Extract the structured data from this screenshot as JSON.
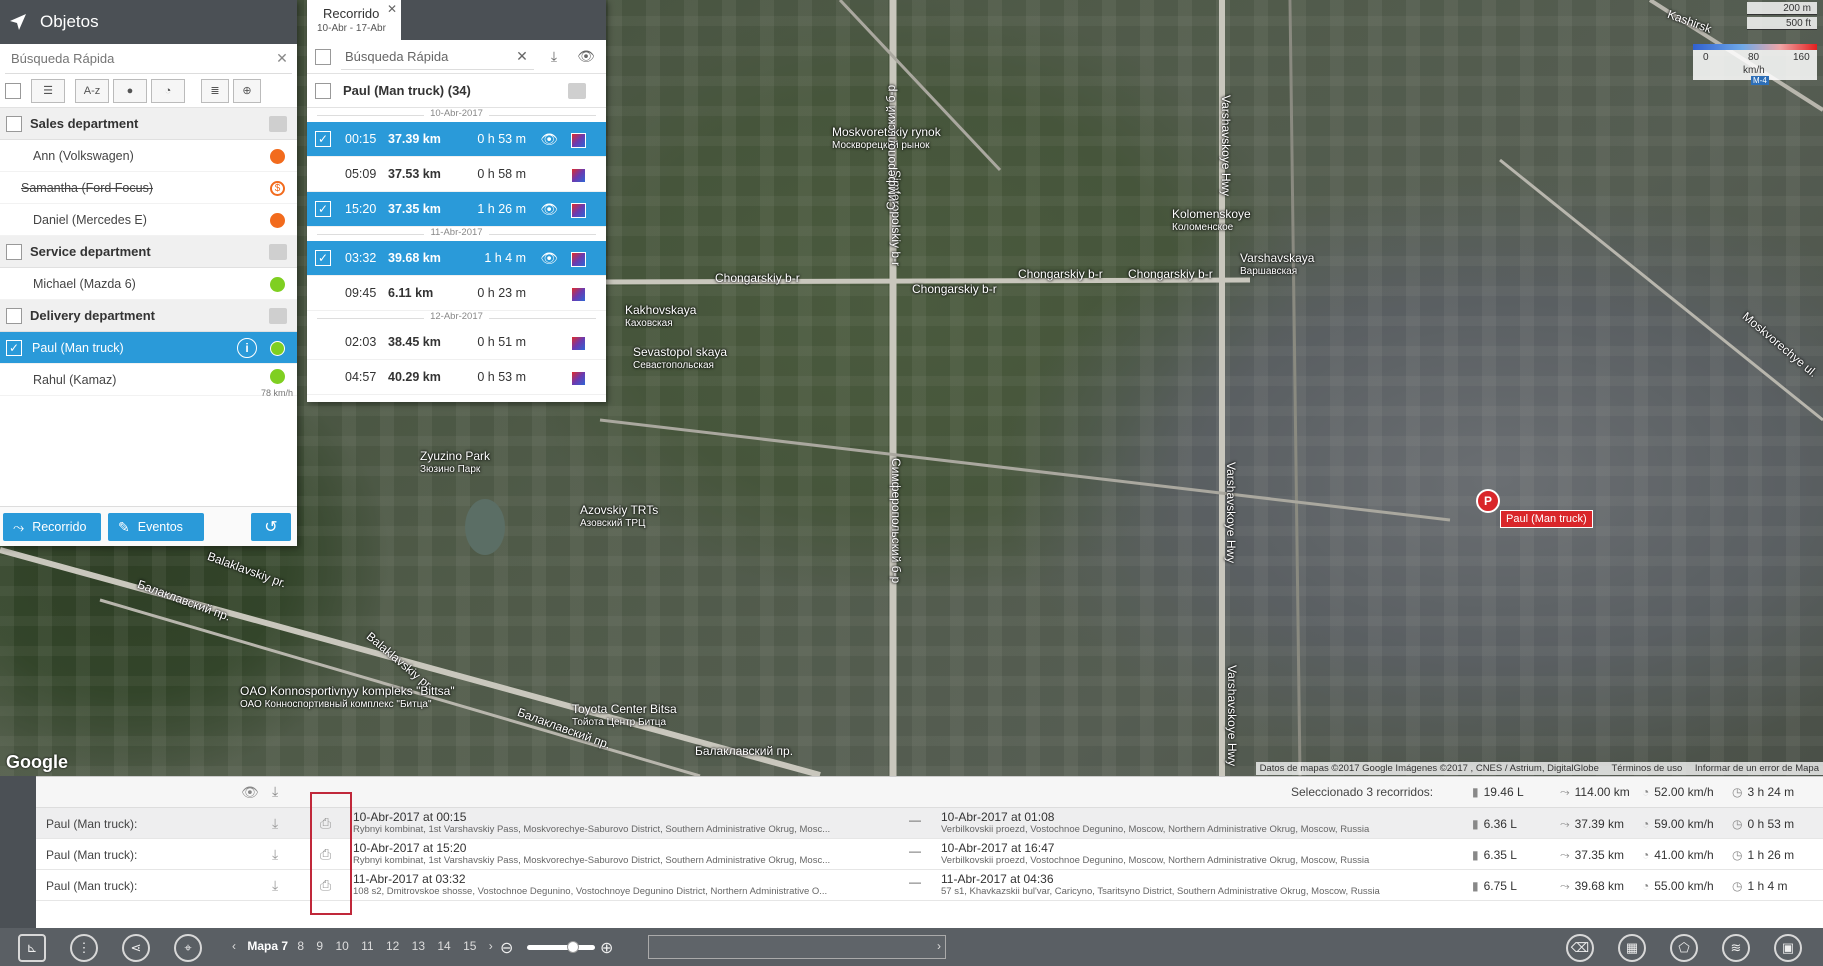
{
  "map": {
    "labels": [
      {
        "text": "Moskvoretskiy rynok",
        "sub": "Москворецкий рынок"
      },
      {
        "text": "Simferopolskiy b-r",
        "sub": ""
      },
      {
        "text": "Chongarskiy b-r",
        "sub": ""
      },
      {
        "text": "Chongarskiy b-r",
        "sub": ""
      },
      {
        "text": "Chongarskiy b-r",
        "sub": ""
      },
      {
        "text": "Chongarskiy b-r",
        "sub": ""
      },
      {
        "text": "Kakhovskaya",
        "sub": "Каховская"
      },
      {
        "text": "Sevastopol skaya",
        "sub": "Севастопольская"
      },
      {
        "text": "Zyuzino Park",
        "sub": "Зюзино Парк"
      },
      {
        "text": "Azovskiy TRTs",
        "sub": "Азовский ТРЦ"
      },
      {
        "text": "Kolomenskoye",
        "sub": "Коломенское"
      },
      {
        "text": "Varshavskaya",
        "sub": "Варшавская"
      },
      {
        "text": "Varshavskoye Hwy",
        "sub": ""
      },
      {
        "text": "Varshavskoye Hwy",
        "sub": ""
      },
      {
        "text": "Varshavskoye Hwy",
        "sub": ""
      },
      {
        "text": "Симферопольский б-р",
        "sub": ""
      },
      {
        "text": "Симферопольский б-р",
        "sub": ""
      },
      {
        "text": "Balaklavskiy pr.",
        "sub": ""
      },
      {
        "text": "Балаклавский пр.",
        "sub": ""
      },
      {
        "text": "Balaklavskiy pr.",
        "sub": ""
      },
      {
        "text": "Балаклавский пр.",
        "sub": ""
      },
      {
        "text": "OAO Konnosportivnyy kompleks \"Bittsa\"",
        "sub": "ОАО Конноспортивный комплекс \"Битца\""
      },
      {
        "text": "Toyota Center Bitsa",
        "sub": "Тойота Центр Битца"
      },
      {
        "text": "Балаклавский пр.",
        "sub": ""
      },
      {
        "text": "Kashirsk",
        "sub": ""
      },
      {
        "text": "Moskvorechye ul.",
        "sub": ""
      }
    ],
    "marker_letter": "P",
    "marker_label": "Paul (Man truck)",
    "google": "Google",
    "attribution": "Datos de mapas ©2017 Google Imágenes ©2017 , CNES / Astrium, DigitalGlobe",
    "terms": "Términos de uso",
    "report": "Informar de un error de Mapa",
    "scale": [
      "200 m",
      "500 ft"
    ],
    "speed_legend": {
      "min": "0",
      "mid": "80",
      "max": "160",
      "unit": "km/h",
      "colors": [
        "#2f5fd0",
        "#e21b1b"
      ]
    },
    "road_sign": "M-4"
  },
  "objects": {
    "title": "Objetos",
    "search_placeholder": "Búsqueda Rápida",
    "sort_label": "A-z",
    "groups": [
      {
        "name": "Sales department",
        "units": [
          {
            "name": "Ann (Volkswagen)",
            "status_color": "#f26b1d",
            "strike": false,
            "icon": "dot"
          },
          {
            "name": "Samantha (Ford Focus)",
            "status_color": "#f26b1d",
            "strike": true,
            "icon": "dollar"
          },
          {
            "name": "Daniel (Mercedes E)",
            "status_color": "#f26b1d",
            "strike": false,
            "icon": "dot"
          }
        ]
      },
      {
        "name": "Service department",
        "units": [
          {
            "name": "Michael (Mazda 6)",
            "status_color": "#7fcf21",
            "strike": false,
            "icon": "dot"
          }
        ]
      },
      {
        "name": "Delivery department",
        "units": [
          {
            "name": "Paul (Man truck)",
            "status_color": "#7fcf21",
            "selected": true,
            "icon": "dot"
          },
          {
            "name": "Rahul (Kamaz)",
            "status_color": "#7fcf21",
            "speed": "78 km/h",
            "icon": "dot"
          }
        ]
      }
    ],
    "footer": {
      "track_label": "Recorrido",
      "events_label": "Eventos"
    }
  },
  "tracks": {
    "tab_title": "Recorrido",
    "tab_range": "10-Abr - 17-Abr",
    "search_placeholder": "Búsqueda Rápida",
    "unit_title": "Paul (Man truck) (34)",
    "days": [
      {
        "date": "10-Abr-2017",
        "trips": [
          {
            "time": "00:15",
            "dist": "37.39 km",
            "dur": "0 h 53 m",
            "selected": true
          },
          {
            "time": "05:09",
            "dist": "37.53 km",
            "dur": "0 h 58 m",
            "selected": false
          },
          {
            "time": "15:20",
            "dist": "37.35 km",
            "dur": "1 h 26 m",
            "selected": true
          }
        ]
      },
      {
        "date": "11-Abr-2017",
        "trips": [
          {
            "time": "03:32",
            "dist": "39.68 km",
            "dur": "1 h 4 m",
            "selected": true
          },
          {
            "time": "09:45",
            "dist": "6.11 km",
            "dur": "0 h 23 m",
            "selected": false
          }
        ]
      },
      {
        "date": "12-Abr-2017",
        "trips": [
          {
            "time": "02:03",
            "dist": "38.45 km",
            "dur": "0 h 51 m",
            "selected": false
          },
          {
            "time": "04:57",
            "dist": "40.29 km",
            "dur": "0 h 53 m",
            "selected": false
          }
        ]
      }
    ]
  },
  "table": {
    "summary": "Seleccionado 3 recorridos:",
    "totals": {
      "fuel": "19.46 L",
      "dist": "114.00 km",
      "speed": "52.00 km/h",
      "time": "3 h 24 m"
    },
    "rows": [
      {
        "unit": "Paul (Man truck):",
        "start_dt": "10-Abr-2017 at 00:15",
        "start_addr": "Rybnyi kombinat, 1st Varshavskiy Pass, Moskvorechye-Saburovo District, Southern Administrative Okrug, Mosc...",
        "end_dt": "10-Abr-2017 at 01:08",
        "end_addr": "Verbilkovskii proezd, Vostochnoe Degunino, Moscow, Northern Administrative Okrug, Moscow, Russia",
        "fuel": "6.36 L",
        "dist": "37.39 km",
        "speed": "59.00 km/h",
        "time": "0 h 53 m"
      },
      {
        "unit": "Paul (Man truck):",
        "start_dt": "10-Abr-2017 at 15:20",
        "start_addr": "Rybnyi kombinat, 1st Varshavskiy Pass, Moskvorechye-Saburovo District, Southern Administrative Okrug, Mosc...",
        "end_dt": "10-Abr-2017 at 16:47",
        "end_addr": "Verbilkovskii proezd, Vostochnoe Degunino, Moscow, Northern Administrative Okrug, Moscow, Russia",
        "fuel": "6.35 L",
        "dist": "37.35 km",
        "speed": "41.00 km/h",
        "time": "1 h 26 m"
      },
      {
        "unit": "Paul (Man truck):",
        "start_dt": "11-Abr-2017 at 03:32",
        "start_addr": "108 s2, Dmitrovskoe shosse, Vostochnoe Degunino, Vostochnoye Degunino District, Northern Administrative O...",
        "end_dt": "11-Abr-2017 at 04:36",
        "end_addr": "57 s1, Khavkazskii bul'var, Caricyno, Tsaritsyno District, Southern Administrative Okrug, Moscow, Russia",
        "fuel": "6.75 L",
        "dist": "39.68 km",
        "speed": "55.00 km/h",
        "time": "1 h 4 m"
      }
    ],
    "dash": "—"
  },
  "bottom_bar": {
    "map_label": "Mapa 7",
    "pages": [
      "8",
      "9",
      "10",
      "11",
      "12",
      "13",
      "14",
      "15"
    ]
  }
}
